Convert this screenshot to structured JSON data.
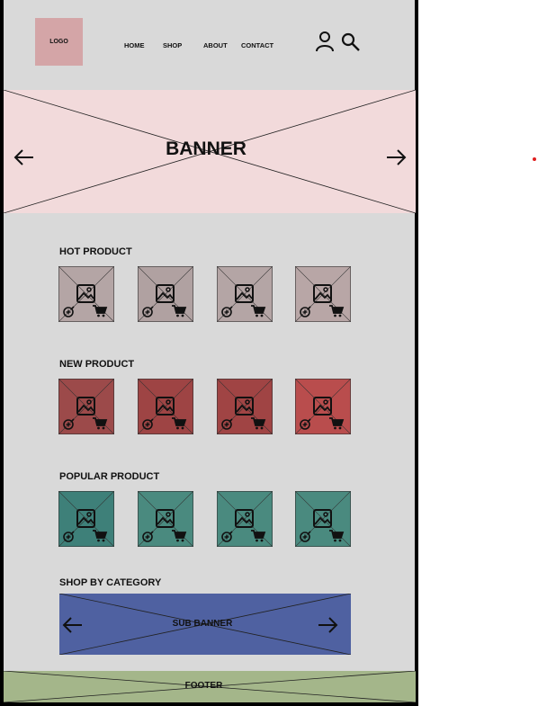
{
  "header": {
    "logo_text": "LOGO",
    "nav": [
      "HOME",
      "SHOP",
      "ABOUT",
      "CONTACT"
    ],
    "icons": [
      "user-icon",
      "search-icon"
    ]
  },
  "banner": {
    "title": "BANNER",
    "color": "#f2dadb",
    "icons": [
      "arrow-left-icon",
      "arrow-right-icon"
    ]
  },
  "sections": [
    {
      "title": "HOT PRODUCT",
      "cards": [
        {
          "color": "#b4a5a5"
        },
        {
          "color": "#b0a1a1"
        },
        {
          "color": "#b4a5a5"
        },
        {
          "color": "#b8a6a6"
        }
      ]
    },
    {
      "title": "NEW PRODUCT",
      "cards": [
        {
          "color": "#9c4a4a"
        },
        {
          "color": "#9e4444"
        },
        {
          "color": "#a04444"
        },
        {
          "color": "#b94d4d"
        }
      ]
    },
    {
      "title": "POPULAR PRODUCT",
      "cards": [
        {
          "color": "#3e8079"
        },
        {
          "color": "#4a8a7f"
        },
        {
          "color": "#4a8a7f"
        },
        {
          "color": "#4a8a7f"
        }
      ]
    }
  ],
  "category": {
    "title": "SHOP BY CATEGORY",
    "sub_banner": "SUB BANNER",
    "color": "#4f61a1"
  },
  "footer": {
    "label": "FOOTER",
    "color": "#a4b68a"
  },
  "card_icons": [
    "image-icon",
    "zoom-in-icon",
    "cart-icon"
  ]
}
